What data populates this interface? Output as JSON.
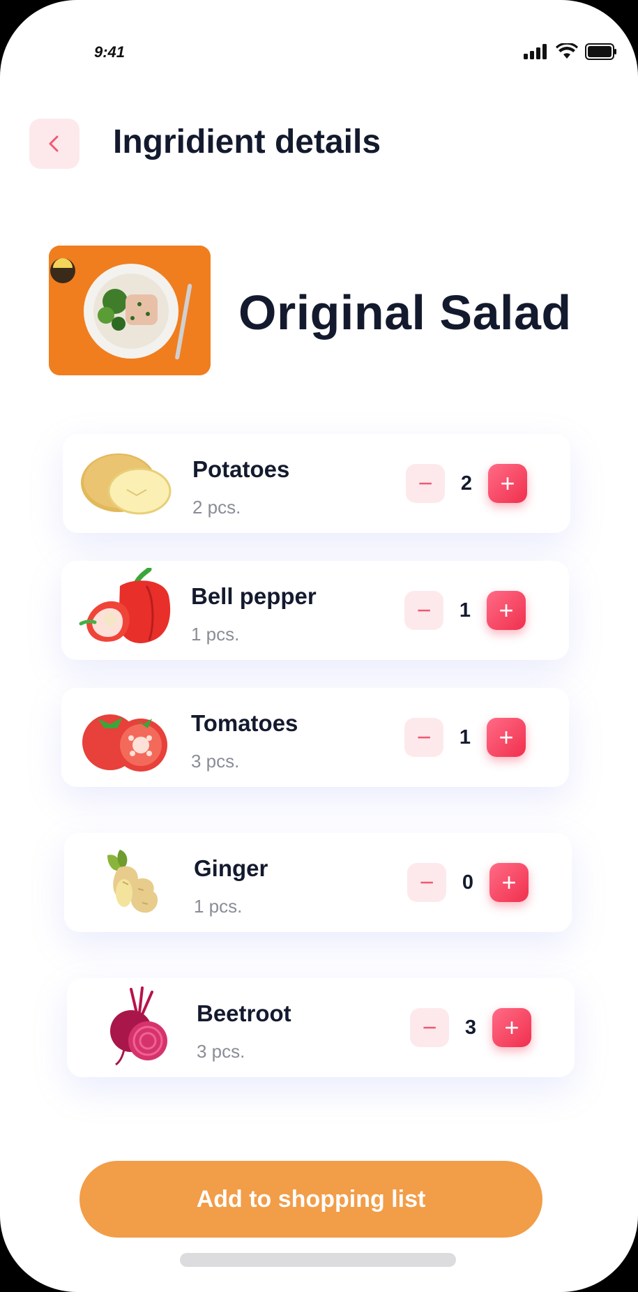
{
  "status_bar": {
    "time": "9:41",
    "icons": [
      "signal-icon",
      "wifi-icon",
      "battery-icon"
    ]
  },
  "header": {
    "back_icon": "chevron-left-icon",
    "title": "Ingridient details"
  },
  "recipe": {
    "image": "salad-plate-photo",
    "title": "Original Salad"
  },
  "ingredients": [
    {
      "name": "Potatoes",
      "amount": "2 pcs.",
      "count": "2",
      "icon": "potato-icon"
    },
    {
      "name": "Bell pepper",
      "amount": "1 pcs.",
      "count": "1",
      "icon": "bell-pepper-icon"
    },
    {
      "name": "Tomatoes",
      "amount": "3 pcs.",
      "count": "1",
      "icon": "tomato-icon"
    },
    {
      "name": "Ginger",
      "amount": "1 pcs.",
      "count": "0",
      "icon": "ginger-icon"
    },
    {
      "name": "Beetroot",
      "amount": "3 pcs.",
      "count": "3",
      "icon": "beetroot-icon"
    }
  ],
  "stepper": {
    "minus": "−",
    "plus": "+"
  },
  "cta": {
    "label": "Add to shopping list"
  },
  "colors": {
    "accent": "#f0304e",
    "accent_soft": "#fde9ec",
    "cta": "#f29d48",
    "title": "#141a2e",
    "muted": "#8a8d96"
  }
}
